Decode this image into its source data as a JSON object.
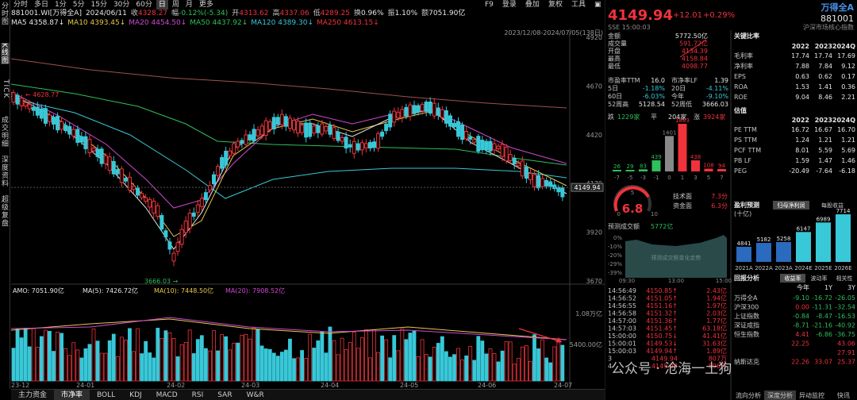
{
  "left_sidebar": [
    "分时图",
    "K线图",
    "TICK",
    "成交明细",
    "深度资料",
    "超级复盘"
  ],
  "period_tabs": [
    "分时",
    "多日",
    "1分",
    "5分",
    "15分",
    "30分",
    "60分",
    "日",
    "周",
    "月",
    "更多"
  ],
  "period_active": "日",
  "toolbar": {
    "f9": "F9",
    "login": "登录",
    "add": "叠加",
    "compare": "复权",
    "tools": "工具"
  },
  "info1": {
    "code": "881001.WI[万得全A]",
    "date": "2024/06/11",
    "close_label": "收",
    "close": "4328.27",
    "chg_label": "幅",
    "chg": "-0.12%(-5.34)",
    "open_label": "开",
    "open": "4313.62",
    "high_label": "高",
    "high": "4337.06",
    "low_label": "低",
    "low": "4289.25",
    "turn_label": "换",
    "turn": "0.96%",
    "amp_label": "振",
    "amp": "1.10%",
    "amt_label": "额",
    "amt": "7051.90亿"
  },
  "ma": [
    {
      "k": "MA5",
      "v": "4358.87↓",
      "c": "#e6e6e6"
    },
    {
      "k": "MA10",
      "v": "4393.45↓",
      "c": "#e6c84a"
    },
    {
      "k": "MA20",
      "v": "4454.50↓",
      "c": "#d048d0"
    },
    {
      "k": "MA50",
      "v": "4437.92↓",
      "c": "#2fbf5b"
    },
    {
      "k": "MA120",
      "v": "4389.30↓",
      "c": "#38c8d8"
    },
    {
      "k": "MA250",
      "v": "4613.15↓",
      "c": "#f0323c"
    }
  ],
  "range_label": "2023/12/08-2024/07/05(138日)",
  "y_ticks": [
    "4920",
    "4670",
    "4420",
    "4170",
    "3920",
    "3670"
  ],
  "price_marks": {
    "high": "4628.77",
    "low": "3666.03",
    "last": "4149.94"
  },
  "amo": {
    "label": "AMO: 7051.90亿",
    "ma5": "MA(5): 7426.72亿",
    "ma10": "MA(10): 7448.50亿",
    "ma20": "MA(20): 7908.52亿",
    "y1": "1.08万亿",
    "y2": "5400.00亿"
  },
  "x_ticks": [
    "23-12",
    "24-01",
    "24-02",
    "24-03",
    "24-04",
    "24-05",
    "24-06",
    "24-07"
  ],
  "bottom_tabs": [
    "主力资金",
    "市净率",
    "BOLL",
    "KDJ",
    "MACD",
    "RSI",
    "SAR",
    "W&R"
  ],
  "bottom_active": "市净率",
  "quote": {
    "name": "万得全A",
    "code": "881001",
    "price": "4149.94",
    "chg": "+12.01",
    "pct": "+0.29%",
    "sse": "SSE 15:00:03",
    "source": "沪深市场核心指数"
  },
  "stats": [
    [
      "金额",
      "5772.50亿"
    ],
    [
      "成交量",
      "591.72亿"
    ],
    [
      "开盘",
      "4134.39"
    ],
    [
      "最高",
      "4158.84"
    ],
    [
      "最低",
      "4098.77"
    ]
  ],
  "stats2": [
    [
      "市盈率TTM",
      "16.0",
      "市净率LF",
      "1.39"
    ],
    [
      "5日",
      "-1.18%",
      "20日",
      "-4.11%"
    ],
    [
      "60日",
      "-6.03%",
      "今年",
      "-9.10%"
    ],
    [
      "52周高",
      "5128.54",
      "52周低",
      "3666.03"
    ]
  ],
  "breadth": {
    "down_label": "跌",
    "down": "1229家",
    "flat_label": "平",
    "flat": "204家",
    "up_label": "涨",
    "up": "3924家"
  },
  "dist_values": [
    26,
    29,
    83,
    439,
    1401,
    1883,
    438,
    108,
    94
  ],
  "dist_labels": [
    "-7",
    "-5",
    "-3",
    "-1",
    "0",
    "1",
    "3",
    "5",
    "7"
  ],
  "gauge": {
    "value": "6.8",
    "min": "0",
    "max": "10",
    "five": "5",
    "tech_label": "技术面",
    "tech": "7.3分",
    "fund_label": "资金面",
    "fund": "6.3分"
  },
  "forecast": {
    "label": "预测成交额",
    "value": "5772亿",
    "axis": [
      "0%",
      "-10%",
      "-20%",
      "-29%",
      "-39%"
    ],
    "center": "预测成交额变化走势",
    "times": [
      "09:30",
      "13:00",
      "15:00"
    ]
  },
  "ticks": [
    [
      "14:56:49",
      "4150.85↑",
      "2.43亿"
    ],
    [
      "14:56:52",
      "4151.05↑",
      "1.94亿"
    ],
    [
      "14:56:55",
      "4151.16↑",
      "1.97亿"
    ],
    [
      "14:56:58",
      "4151.32↑",
      "2.03亿"
    ],
    [
      "14:57:00",
      "4151.36↑",
      "1.77亿"
    ],
    [
      "14:57:03",
      "4151.45↑",
      "63.18亿"
    ],
    [
      "15:00:00",
      "4150.75↓",
      "41.41亿"
    ],
    [
      "15:00:01",
      "4149.53↓",
      "31.63亿"
    ],
    [
      "15:00:03",
      "4149.94↑",
      "1.89亿"
    ],
    [
      "3",
      "4149.94",
      "807万"
    ],
    [
      "4",
      "4149.94",
      "596万"
    ]
  ],
  "ratios_title": "关键比率",
  "ratios_years": [
    "2022",
    "2023",
    "2024Q"
  ],
  "ratios": [
    [
      "毛利率",
      "17.74",
      "17.74",
      "17.69"
    ],
    [
      "净利率",
      "7.88",
      "7.84",
      "9.12"
    ],
    [
      "EPS",
      "0.63",
      "0.62",
      "0.17"
    ],
    [
      "ROA",
      "1.53",
      "1.41",
      "0.36"
    ],
    [
      "ROE",
      "9.04",
      "8.46",
      "2.21"
    ]
  ],
  "val_title": "估值",
  "val_years": [
    "2022",
    "2023",
    "2024Q"
  ],
  "val": [
    [
      "PE TTM",
      "16.72",
      "16.67",
      "16.70"
    ],
    [
      "PS TTM",
      "1.24",
      "1.21",
      "1.21"
    ],
    [
      "PCF TTM",
      "8.01",
      "5.59",
      "5.69"
    ],
    [
      "PB LF",
      "1.59",
      "1.47",
      "1.46"
    ],
    [
      "PEG",
      "-20.49",
      "-7.64",
      "-6.18"
    ]
  ],
  "forecast2": {
    "title": "盈利预测",
    "sub": "(十亿)",
    "tab1": "归母净利润",
    "tab2": "每股收益",
    "values": [
      4841,
      5182,
      5258,
      6147,
      6989,
      7714
    ],
    "years": [
      "2021A",
      "2022A",
      "2023A",
      "2024E",
      "2025E",
      "2026E"
    ]
  },
  "perf": {
    "title": "回报分析",
    "tab1": "收益率",
    "tab2": "波动率",
    "tab3": "相关性",
    "cols": [
      "今年",
      "1Y",
      "3Y"
    ],
    "rows": [
      [
        "万得全A",
        "-9.10",
        "-16.72",
        "-26.05"
      ],
      [
        "沪深300",
        "0.00",
        "-11.31",
        "-32.54"
      ],
      [
        "上证指数",
        "-0.84",
        "-8.47",
        "-16.53"
      ],
      [
        "深证成指",
        "-8.71",
        "-21.16",
        "-40.92"
      ],
      [
        "恒生指数",
        "4.41",
        "-6.86",
        "-36.75"
      ],
      [
        "",
        "22.25",
        "",
        "43.06"
      ],
      [
        "",
        "",
        "",
        "27.91"
      ],
      [
        "纳斯达克",
        "22.26",
        "33.07",
        "25.37"
      ]
    ]
  },
  "right_bottom_tabs": [
    "流向分析",
    "深度分析",
    "异动监控",
    "快讯"
  ],
  "watermark": "公众号 · 沧海一土狗",
  "colors": {
    "up": "#f0323c",
    "down": "#38c8d8",
    "bg": "#000000"
  }
}
